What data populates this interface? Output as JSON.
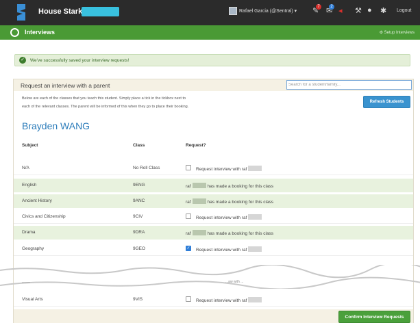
{
  "app": {
    "title": "House Stark",
    "badge": "",
    "user_menu": "Rafael Garcia (@Sentral) ▾",
    "notif_count_1": "7",
    "notif_count_2": "2",
    "logout": "Logout"
  },
  "header": {
    "title": "Interviews",
    "setup_link": "⚙ Setup Interviews"
  },
  "alert": {
    "text": "We've successfully saved your interview requests!"
  },
  "panel": {
    "title": "Request an interview with a parent",
    "search_placeholder": "Search for a student/family...",
    "description_line1": "Below are each of the classes that you teach this student. Simply place a tick in the tickbox next to",
    "description_line2": "each of the relevant classes. The parent will be informed of this when they go to place their booking.",
    "refresh_button": "Refresh Students",
    "student_name": "Brayden WANG",
    "columns": {
      "subject": "Subject",
      "class": "Class",
      "request": "Request?"
    },
    "rows": [
      {
        "subject": "N/A",
        "class": "No Roll Class",
        "type": "request",
        "checked": false,
        "text": "Request interview with raf"
      },
      {
        "subject": "English",
        "class": "9ENG",
        "type": "booked",
        "text_a": "raf",
        "text_b": "has made a booking for this class"
      },
      {
        "subject": "Ancient History",
        "class": "9ANC",
        "type": "booked",
        "text_a": "raf",
        "text_b": "has made a booking for this class"
      },
      {
        "subject": "Civics and Citizenship",
        "class": "9CIV",
        "type": "request",
        "checked": false,
        "text": "Request interview with raf"
      },
      {
        "subject": "Drama",
        "class": "9DRA",
        "type": "booked",
        "text_a": "raf",
        "text_b": "has made a booking for this class"
      },
      {
        "subject": "Geography",
        "class": "9GEO",
        "type": "request",
        "checked": true,
        "text": "Request interview with raf"
      },
      {
        "subject": "Visual Arts",
        "class": "9VIS",
        "type": "request",
        "checked": false,
        "text": "Request interview with raf"
      }
    ],
    "torn_fragment_text": "...aw with ...",
    "confirm_button": "Confirm Interview Requests"
  },
  "colors": {
    "navbar": "#2b2b2b",
    "header_green": "#4a9a35",
    "alert_bg": "#e4efd8",
    "row_green": "#e8f2de",
    "link_blue": "#2c7cba",
    "refresh_blue": "#3a93cf",
    "confirm_green": "#4aa03b"
  },
  "icons": [
    "sentral-logo-icon",
    "user-avatar-icon",
    "notification-icon",
    "message-icon",
    "announcement-icon",
    "wrench-icon",
    "help-icon",
    "gear-icon",
    "interviews-icon",
    "check-circle-icon",
    "checkbox-icon"
  ]
}
